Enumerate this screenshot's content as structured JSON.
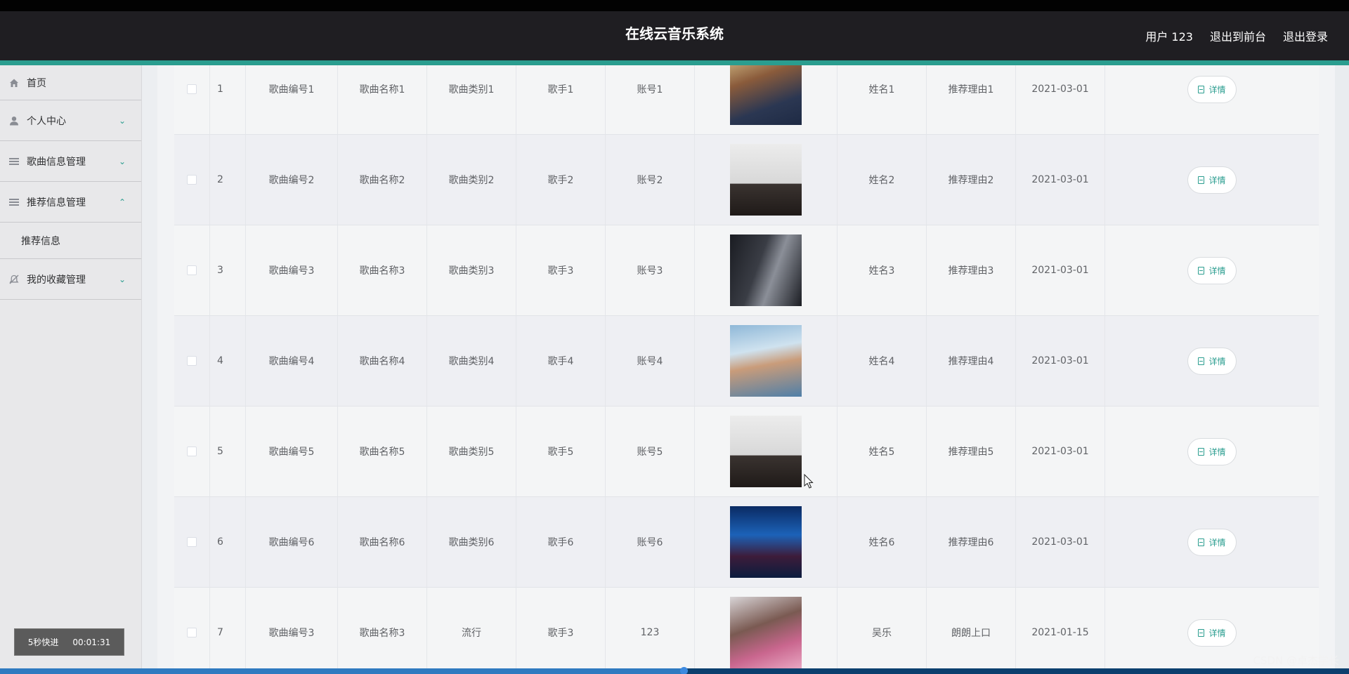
{
  "header": {
    "title": "在线云音乐系统",
    "user": "用户 123",
    "to_front": "退出到前台",
    "logout": "退出登录"
  },
  "sidebar": {
    "items": [
      {
        "label": "首页",
        "icon": "home-icon"
      },
      {
        "label": "个人中心",
        "icon": "user-icon"
      },
      {
        "label": "歌曲信息管理",
        "icon": "menu-icon"
      },
      {
        "label": "推荐信息管理",
        "icon": "menu-icon"
      },
      {
        "label": "我的收藏管理",
        "icon": "bell-off-icon"
      }
    ],
    "submenu_active": "推荐信息"
  },
  "table": {
    "rows": [
      {
        "idx": "1",
        "code": "歌曲编号1",
        "name": "歌曲名称1",
        "type": "歌曲类别1",
        "singer": "歌手1",
        "account": "账号1",
        "real_name": "姓名1",
        "reason": "推荐理由1",
        "date": "2021-03-01",
        "action": "详情"
      },
      {
        "idx": "2",
        "code": "歌曲编号2",
        "name": "歌曲名称2",
        "type": "歌曲类别2",
        "singer": "歌手2",
        "account": "账号2",
        "real_name": "姓名2",
        "reason": "推荐理由2",
        "date": "2021-03-01",
        "action": "详情"
      },
      {
        "idx": "3",
        "code": "歌曲编号3",
        "name": "歌曲名称3",
        "type": "歌曲类别3",
        "singer": "歌手3",
        "account": "账号3",
        "real_name": "姓名3",
        "reason": "推荐理由3",
        "date": "2021-03-01",
        "action": "详情"
      },
      {
        "idx": "4",
        "code": "歌曲编号4",
        "name": "歌曲名称4",
        "type": "歌曲类别4",
        "singer": "歌手4",
        "account": "账号4",
        "real_name": "姓名4",
        "reason": "推荐理由4",
        "date": "2021-03-01",
        "action": "详情"
      },
      {
        "idx": "5",
        "code": "歌曲编号5",
        "name": "歌曲名称5",
        "type": "歌曲类别5",
        "singer": "歌手5",
        "account": "账号5",
        "real_name": "姓名5",
        "reason": "推荐理由5",
        "date": "2021-03-01",
        "action": "详情"
      },
      {
        "idx": "6",
        "code": "歌曲编号6",
        "name": "歌曲名称6",
        "type": "歌曲类别6",
        "singer": "歌手6",
        "account": "账号6",
        "real_name": "姓名6",
        "reason": "推荐理由6",
        "date": "2021-03-01",
        "action": "详情"
      },
      {
        "idx": "7",
        "code": "歌曲编号3",
        "name": "歌曲名称3",
        "type": "流行",
        "singer": "歌手3",
        "account": "123",
        "real_name": "吴乐",
        "reason": "朗朗上口",
        "date": "2021-01-15",
        "action": "详情"
      }
    ]
  },
  "video": {
    "speed_label": "5秒快进",
    "time": "00:01:31",
    "progress": 0.507
  },
  "watermark": "CSDN @卓杰学长",
  "colors": {
    "accent": "#2a9d8f",
    "header_bg": "#1f1e22"
  }
}
